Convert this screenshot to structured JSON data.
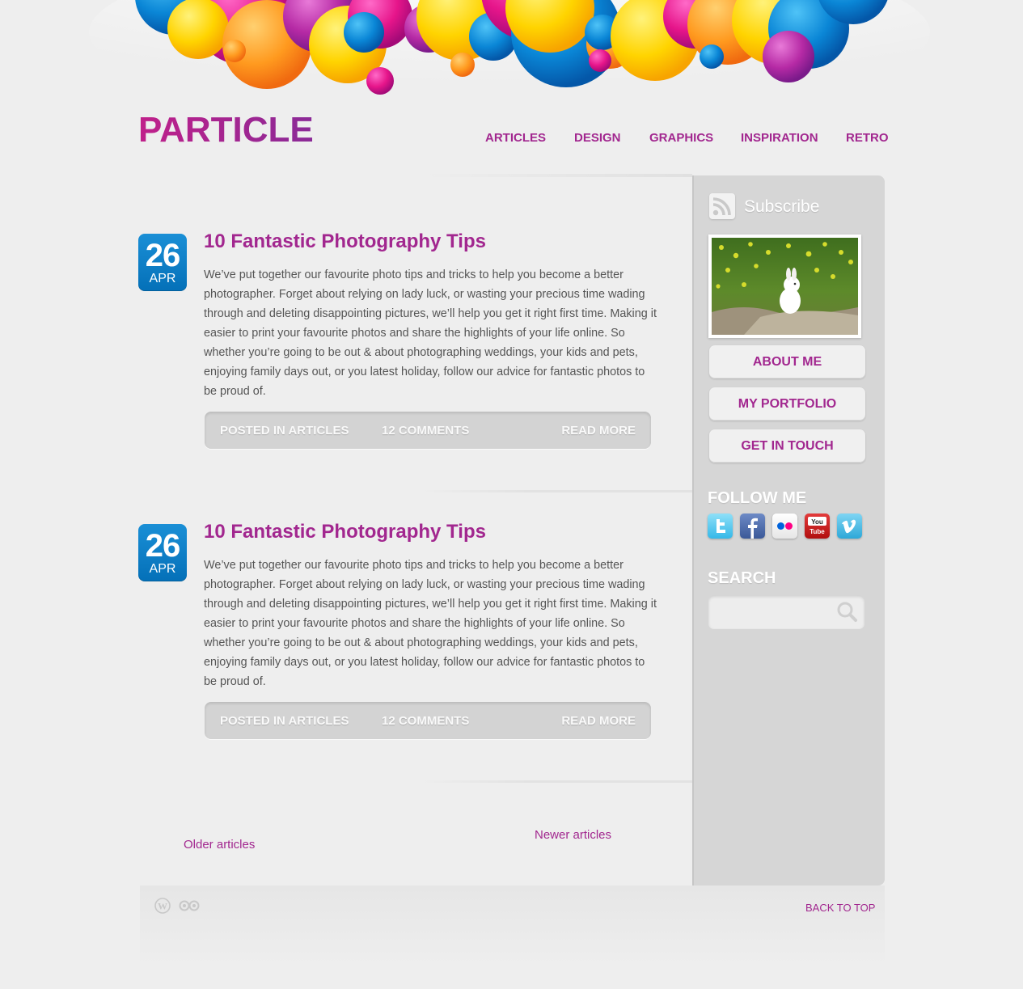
{
  "site": {
    "title": "PARTICLE"
  },
  "nav": {
    "items": [
      "ARTICLES",
      "DESIGN",
      "GRAPHICS",
      "INSPIRATION",
      "RETRO"
    ]
  },
  "posts": [
    {
      "day": "26",
      "month": "APR",
      "title": "10 Fantastic Photography Tips",
      "body": "We’ve put together our favourite photo tips and tricks to help you become a better photographer. Forget about relying on lady luck, or wasting your precious time wading through and deleting disappointing pictures, we’ll help you get it right first time. Making it easier to print your favourite photos and share the highlights of your life online. So whether you’re going to be out & about photographing weddings, your kids and pets, enjoying family days out, or you latest holiday, follow our advice for fantastic photos to be proud of.",
      "category": "POSTED IN ARTICLES",
      "comments": "12 COMMENTS",
      "read_more": "READ MORE"
    },
    {
      "day": "26",
      "month": "APR",
      "title": "10 Fantastic Photography Tips",
      "body": "We’ve put together our favourite photo tips and tricks to help you become a better photographer. Forget about relying on lady luck, or wasting your precious time wading through and deleting disappointing pictures, we’ll help you get it right first time. Making it easier to print your favourite photos and share the highlights of your life online. So whether you’re going to be out & about photographing weddings, your kids and pets, enjoying family days out, or you latest holiday, follow our advice for fantastic photos to be proud of.",
      "category": "POSTED IN ARTICLES",
      "comments": "12 COMMENTS",
      "read_more": "READ MORE"
    }
  ],
  "pagination": {
    "older": "Older articles",
    "newer": "Newer articles"
  },
  "sidebar": {
    "subscribe": "Subscribe",
    "photo_icon": "bunny-photo",
    "buttons": [
      "ABOUT ME",
      "MY PORTFOLIO",
      "GET IN TOUCH"
    ],
    "follow_heading": "FOLLOW ME",
    "social": [
      "twitter-icon",
      "facebook-icon",
      "flickr-icon",
      "youtube-icon",
      "vimeo-icon"
    ],
    "search_heading": "SEARCH",
    "search_placeholder": ""
  },
  "footer": {
    "back_to_top": "BACK TO TOP",
    "icons": [
      "wordpress-icon",
      "tripadvisor-icon"
    ]
  },
  "colors": {
    "accent": "#a2278f",
    "date_badge": "#0a7cc6",
    "sidebar": "#d6d6d6",
    "background": "#eeeeee"
  }
}
